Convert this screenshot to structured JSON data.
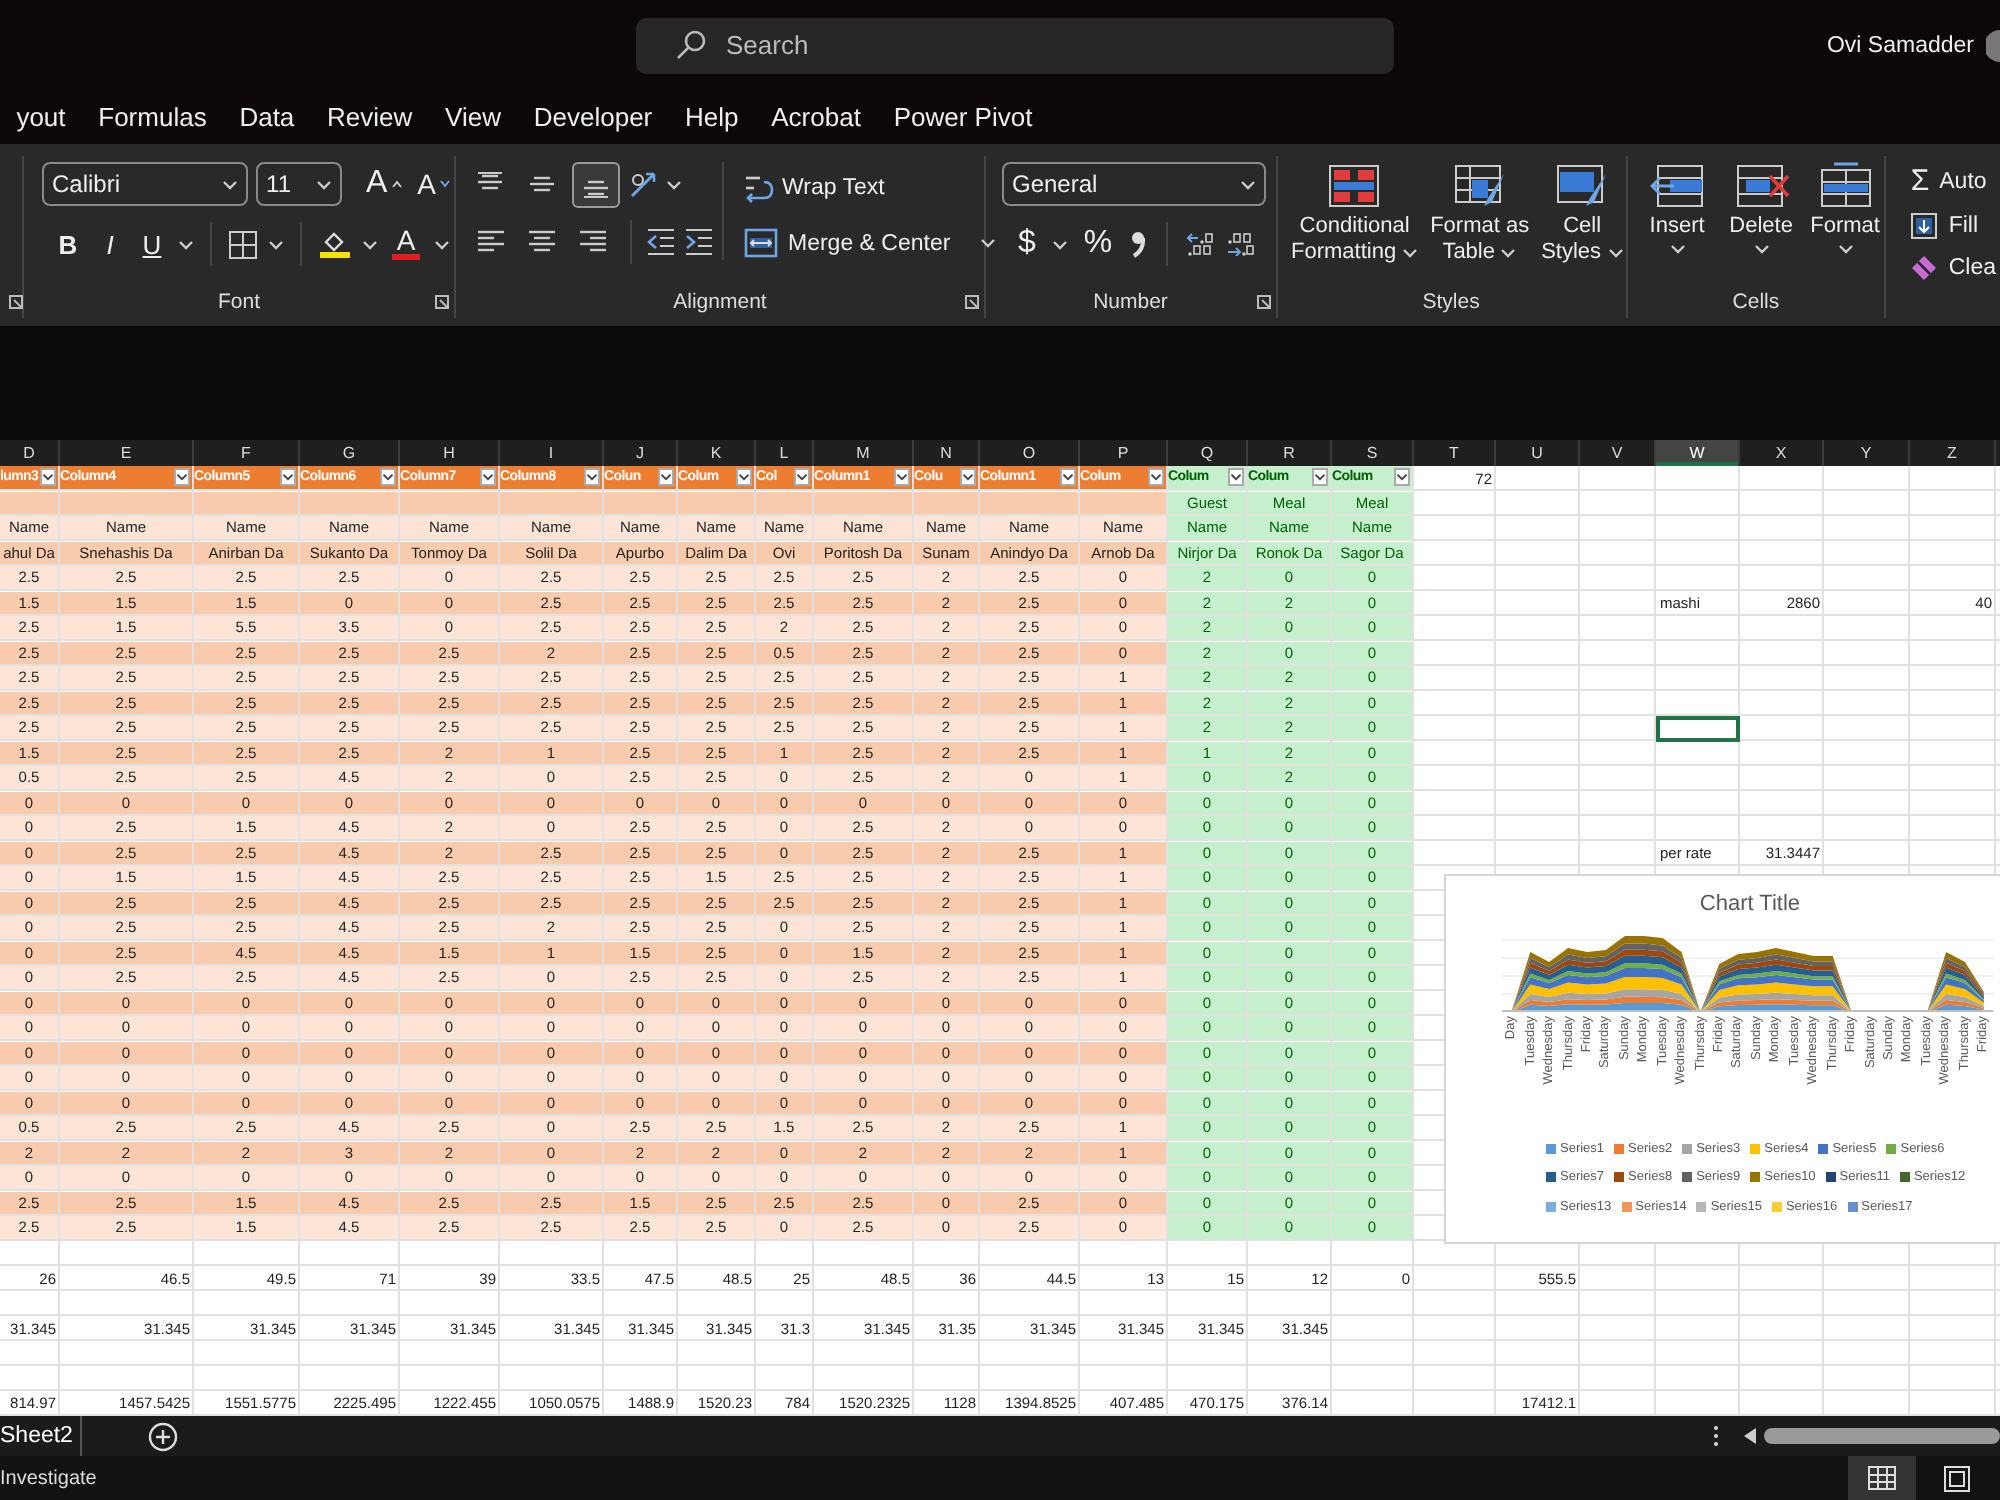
{
  "title_bar": {
    "search_placeholder": "Search",
    "user_name": "Ovi Samadder"
  },
  "menu_tabs": [
    "yout",
    "Formulas",
    "Data",
    "Review",
    "View",
    "Developer",
    "Help",
    "Acrobat",
    "Power Pivot"
  ],
  "ribbon": {
    "groups": [
      {
        "kind": "font",
        "label": "Font",
        "font_name": "Calibri",
        "font_size": "11",
        "grow_font": "A",
        "shrink_font": "A",
        "style_buttons": [
          "B",
          "I",
          "U"
        ],
        "font_color": "A"
      },
      {
        "kind": "alignment",
        "label": "Alignment",
        "valign_buttons": [
          {
            "selected": false
          },
          {
            "selected": false
          },
          {
            "selected": true
          }
        ],
        "wrap_text": "Wrap Text",
        "merge": "Merge & Center"
      },
      {
        "kind": "number",
        "label": "Number",
        "format": "General",
        "currency": "$",
        "percent": "%"
      },
      {
        "kind": "styles",
        "label": "Styles",
        "buttons": [
          "Conditional\nFormatting",
          "Format as\nTable",
          "Cell\nStyles"
        ]
      },
      {
        "kind": "cells",
        "label": "Cells",
        "buttons": [
          "Insert",
          "Delete",
          "Format"
        ]
      },
      {
        "kind": "editing",
        "autosum_symbol": "Σ",
        "buttons": [
          "Auto",
          "Fill",
          "Clea"
        ]
      }
    ]
  },
  "sheet": {
    "columns": [
      {
        "letter": "D",
        "kind": "orange",
        "selected": false
      },
      {
        "letter": "E",
        "kind": "orange",
        "selected": false
      },
      {
        "letter": "F",
        "kind": "orange",
        "selected": false
      },
      {
        "letter": "G",
        "kind": "orange",
        "selected": false
      },
      {
        "letter": "H",
        "kind": "orange",
        "selected": false
      },
      {
        "letter": "I",
        "kind": "orange",
        "selected": false
      },
      {
        "letter": "J",
        "kind": "orange",
        "selected": false
      },
      {
        "letter": "K",
        "kind": "orange",
        "selected": false
      },
      {
        "letter": "L",
        "kind": "orange",
        "selected": false
      },
      {
        "letter": "M",
        "kind": "orange",
        "selected": false
      },
      {
        "letter": "N",
        "kind": "orange",
        "selected": false
      },
      {
        "letter": "O",
        "kind": "orange",
        "selected": false
      },
      {
        "letter": "P",
        "kind": "orange",
        "selected": false
      },
      {
        "letter": "Q",
        "kind": "green",
        "selected": false
      },
      {
        "letter": "R",
        "kind": "green",
        "selected": false
      },
      {
        "letter": "S",
        "kind": "green",
        "selected": false
      },
      {
        "letter": "T",
        "kind": "plain",
        "selected": false
      },
      {
        "letter": "U",
        "kind": "plain",
        "selected": false
      },
      {
        "letter": "V",
        "kind": "plain",
        "selected": false
      },
      {
        "letter": "W",
        "kind": "plain",
        "selected": true
      },
      {
        "letter": "X",
        "kind": "plain",
        "selected": false
      },
      {
        "letter": "Y",
        "kind": "plain",
        "selected": false
      },
      {
        "letter": "Z",
        "kind": "plain",
        "selected": false
      }
    ],
    "rows": [
      {
        "kind": "header",
        "cells": [
          "lumn3",
          "Column4",
          "Column5",
          "Column6",
          "Column7",
          "Column8",
          "Colun",
          "Colum",
          "Col",
          "Column1",
          "Colu",
          "Column1",
          "Colum",
          "Colum",
          "Colum",
          "Colum",
          "72"
        ]
      },
      {
        "kind": "band",
        "cells": [
          null,
          null,
          null,
          null,
          null,
          null,
          null,
          null,
          null,
          null,
          null,
          null,
          null,
          "Guest",
          "Meal",
          "Meal"
        ]
      },
      {
        "kind": "band",
        "cells": [
          "Name",
          "Name",
          "Name",
          "Name",
          "Name",
          "Name",
          "Name",
          "Name",
          "Name",
          "Name",
          "Name",
          "Name",
          "Name",
          "Name",
          "Name",
          "Name"
        ]
      },
      {
        "kind": "band",
        "cells": [
          "ahul Da",
          "Snehashis Da",
          "Anirban Da",
          "Sukanto Da",
          "Tonmoy Da",
          "Solil Da",
          "Apurbo",
          "Dalim Da",
          "Ovi",
          "Poritosh Da",
          "Sunam",
          "Anindyo Da",
          "Arnob Da",
          "Nirjor Da",
          "Ronok Da",
          "Sagor Da"
        ]
      },
      {
        "kind": "band",
        "cells": [
          "2.5",
          "2.5",
          "2.5",
          "2.5",
          "0",
          "2.5",
          "2.5",
          "2.5",
          "2.5",
          "2.5",
          "2",
          "2.5",
          "0",
          "2",
          "0",
          "0"
        ]
      },
      {
        "kind": "band",
        "cells": [
          "1.5",
          "1.5",
          "1.5",
          "0",
          "0",
          "2.5",
          "2.5",
          "2.5",
          "2.5",
          "2.5",
          "2",
          "2.5",
          "0",
          "2",
          "2",
          "0",
          null,
          null,
          null,
          "mashi",
          "2860",
          null,
          "40"
        ]
      },
      {
        "kind": "band",
        "cells": [
          "2.5",
          "1.5",
          "5.5",
          "3.5",
          "0",
          "2.5",
          "2.5",
          "2.5",
          "2",
          "2.5",
          "2",
          "2.5",
          "0",
          "2",
          "0",
          "0"
        ]
      },
      {
        "kind": "band",
        "cells": [
          "2.5",
          "2.5",
          "2.5",
          "2.5",
          "2.5",
          "2",
          "2.5",
          "2.5",
          "0.5",
          "2.5",
          "2",
          "2.5",
          "0",
          "2",
          "0",
          "0"
        ]
      },
      {
        "kind": "band",
        "cells": [
          "2.5",
          "2.5",
          "2.5",
          "2.5",
          "2.5",
          "2.5",
          "2.5",
          "2.5",
          "2.5",
          "2.5",
          "2",
          "2.5",
          "1",
          "2",
          "2",
          "0"
        ]
      },
      {
        "kind": "band",
        "cells": [
          "2.5",
          "2.5",
          "2.5",
          "2.5",
          "2.5",
          "2.5",
          "2.5",
          "2.5",
          "2.5",
          "2.5",
          "2",
          "2.5",
          "1",
          "2",
          "2",
          "0"
        ]
      },
      {
        "kind": "band",
        "cells": [
          "2.5",
          "2.5",
          "2.5",
          "2.5",
          "2.5",
          "2.5",
          "2.5",
          "2.5",
          "2.5",
          "2.5",
          "2",
          "2.5",
          "1",
          "2",
          "2",
          "0",
          null,
          null,
          null,
          {
            "selected": true
          }
        ]
      },
      {
        "kind": "band",
        "cells": [
          "1.5",
          "2.5",
          "2.5",
          "2.5",
          "2",
          "1",
          "2.5",
          "2.5",
          "1",
          "2.5",
          "2",
          "2.5",
          "1",
          "1",
          "2",
          "0"
        ]
      },
      {
        "kind": "band",
        "cells": [
          "0.5",
          "2.5",
          "2.5",
          "4.5",
          "2",
          "0",
          "2.5",
          "2.5",
          "0",
          "2.5",
          "2",
          "0",
          "1",
          "0",
          "2",
          "0"
        ]
      },
      {
        "kind": "band",
        "cells": [
          "0",
          "0",
          "0",
          "0",
          "0",
          "0",
          "0",
          "0",
          "0",
          "0",
          "0",
          "0",
          "0",
          "0",
          "0",
          "0"
        ]
      },
      {
        "kind": "band",
        "cells": [
          "0",
          "2.5",
          "1.5",
          "4.5",
          "2",
          "0",
          "2.5",
          "2.5",
          "0",
          "2.5",
          "2",
          "0",
          "0",
          "0",
          "0",
          "0"
        ]
      },
      {
        "kind": "band",
        "cells": [
          "0",
          "2.5",
          "2.5",
          "4.5",
          "2",
          "2.5",
          "2.5",
          "2.5",
          "0",
          "2.5",
          "2",
          "2.5",
          "1",
          "0",
          "0",
          "0",
          null,
          null,
          null,
          "per rate",
          "31.3447"
        ]
      },
      {
        "kind": "band",
        "cells": [
          "0",
          "1.5",
          "1.5",
          "4.5",
          "2.5",
          "2.5",
          "2.5",
          "1.5",
          "2.5",
          "2.5",
          "2",
          "2.5",
          "1",
          "0",
          "0",
          "0"
        ]
      },
      {
        "kind": "band",
        "cells": [
          "0",
          "2.5",
          "2.5",
          "4.5",
          "2.5",
          "2.5",
          "2.5",
          "2.5",
          "2.5",
          "2.5",
          "2",
          "2.5",
          "1",
          "0",
          "0",
          "0"
        ]
      },
      {
        "kind": "band",
        "cells": [
          "0",
          "2.5",
          "2.5",
          "4.5",
          "2.5",
          "2",
          "2.5",
          "2.5",
          "0",
          "2.5",
          "2",
          "2.5",
          "1",
          "0",
          "0",
          "0"
        ]
      },
      {
        "kind": "band",
        "cells": [
          "0",
          "2.5",
          "4.5",
          "4.5",
          "1.5",
          "1",
          "1.5",
          "2.5",
          "0",
          "1.5",
          "2",
          "2.5",
          "1",
          "0",
          "0",
          "0"
        ]
      },
      {
        "kind": "band",
        "cells": [
          "0",
          "2.5",
          "2.5",
          "4.5",
          "2.5",
          "0",
          "2.5",
          "2.5",
          "0",
          "2.5",
          "2",
          "2.5",
          "1",
          "0",
          "0",
          "0"
        ]
      },
      {
        "kind": "band",
        "cells": [
          "0",
          "0",
          "0",
          "0",
          "0",
          "0",
          "0",
          "0",
          "0",
          "0",
          "0",
          "0",
          "0",
          "0",
          "0",
          "0"
        ]
      },
      {
        "kind": "band",
        "cells": [
          "0",
          "0",
          "0",
          "0",
          "0",
          "0",
          "0",
          "0",
          "0",
          "0",
          "0",
          "0",
          "0",
          "0",
          "0",
          "0"
        ]
      },
      {
        "kind": "band",
        "cells": [
          "0",
          "0",
          "0",
          "0",
          "0",
          "0",
          "0",
          "0",
          "0",
          "0",
          "0",
          "0",
          "0",
          "0",
          "0",
          "0"
        ]
      },
      {
        "kind": "band",
        "cells": [
          "0",
          "0",
          "0",
          "0",
          "0",
          "0",
          "0",
          "0",
          "0",
          "0",
          "0",
          "0",
          "0",
          "0",
          "0",
          "0"
        ]
      },
      {
        "kind": "band",
        "cells": [
          "0",
          "0",
          "0",
          "0",
          "0",
          "0",
          "0",
          "0",
          "0",
          "0",
          "0",
          "0",
          "0",
          "0",
          "0",
          "0"
        ]
      },
      {
        "kind": "band",
        "cells": [
          "0.5",
          "2.5",
          "2.5",
          "4.5",
          "2.5",
          "0",
          "2.5",
          "2.5",
          "1.5",
          "2.5",
          "2",
          "2.5",
          "1",
          "0",
          "0",
          "0"
        ]
      },
      {
        "kind": "band",
        "cells": [
          "2",
          "2",
          "2",
          "3",
          "2",
          "0",
          "2",
          "2",
          "0",
          "2",
          "2",
          "2",
          "1",
          "0",
          "0",
          "0"
        ]
      },
      {
        "kind": "band",
        "cells": [
          "0",
          "0",
          "0",
          "0",
          "0",
          "0",
          "0",
          "0",
          "0",
          "0",
          "0",
          "0",
          "0",
          "0",
          "0",
          "0"
        ]
      },
      {
        "kind": "band",
        "cells": [
          "2.5",
          "2.5",
          "1.5",
          "4.5",
          "2.5",
          "2.5",
          "1.5",
          "2.5",
          "2.5",
          "2.5",
          "0",
          "2.5",
          "0",
          "0",
          "0",
          "0"
        ]
      },
      {
        "kind": "band",
        "cells": [
          "2.5",
          "2.5",
          "1.5",
          "4.5",
          "2.5",
          "2.5",
          "2.5",
          "2.5",
          "0",
          "2.5",
          "0",
          "2.5",
          "0",
          "0",
          "0",
          "0"
        ]
      },
      {
        "kind": "plain"
      },
      {
        "kind": "plain",
        "cells": [
          "26",
          "46.5",
          "49.5",
          "71",
          "39",
          "33.5",
          "47.5",
          "48.5",
          "25",
          "48.5",
          "36",
          "44.5",
          "13",
          "15",
          "12",
          "0",
          null,
          "555.5"
        ]
      },
      {
        "kind": "plain"
      },
      {
        "kind": "plain",
        "cells": [
          "31.345",
          "31.345",
          "31.345",
          "31.345",
          "31.345",
          "31.345",
          "31.345",
          "31.345",
          "31.3",
          "31.345",
          "31.35",
          "31.345",
          "31.345",
          "31.345",
          "31.345"
        ]
      },
      {
        "kind": "plain"
      },
      {
        "kind": "plain"
      },
      {
        "kind": "plain",
        "cells": [
          "814.97",
          "1457.5425",
          "1551.5775",
          "2225.495",
          "1222.455",
          "1050.0575",
          "1488.9",
          "1520.23",
          "784",
          "1520.2325",
          "1128",
          "1394.8525",
          "407.485",
          "470.175",
          "376.14",
          null,
          null,
          "17412.1"
        ]
      }
    ]
  },
  "chart": {
    "title": "Chart Title",
    "categories": [
      "Day",
      "Tuesday",
      "Wednesday",
      "Thursday",
      "Friday",
      "Saturday",
      "Sunday",
      "Monday",
      "Tuesday",
      "Wednesday",
      "Thursday",
      "Friday",
      "Saturday",
      "Sunday",
      "Monday",
      "Tuesday",
      "Wednesday",
      "Thursday",
      "Friday",
      "Saturday",
      "Sunday",
      "Monday",
      "Tuesday",
      "Wednesday",
      "Thursday",
      "Friday"
    ],
    "legend": [
      {
        "name": "Series1",
        "color": "#5b9bd5"
      },
      {
        "name": "Series2",
        "color": "#ed7d31"
      },
      {
        "name": "Series3",
        "color": "#a5a5a5"
      },
      {
        "name": "Series4",
        "color": "#ffc000"
      },
      {
        "name": "Series5",
        "color": "#4472c4"
      },
      {
        "name": "Series6",
        "color": "#70ad47"
      },
      {
        "name": "Series7",
        "color": "#255e91"
      },
      {
        "name": "Series8",
        "color": "#9e480e"
      },
      {
        "name": "Series9",
        "color": "#636363"
      },
      {
        "name": "Series10",
        "color": "#997300"
      },
      {
        "name": "Series11",
        "color": "#264478"
      },
      {
        "name": "Series12",
        "color": "#43682b"
      },
      {
        "name": "Series13",
        "color": "#7cafdd"
      },
      {
        "name": "Series14",
        "color": "#f1975a"
      },
      {
        "name": "Series15",
        "color": "#b7b7b7"
      },
      {
        "name": "Series16",
        "color": "#ffcd33"
      },
      {
        "name": "Series17",
        "color": "#698ed0"
      }
    ]
  },
  "sheet_tabs": [
    "Sheet2"
  ],
  "status_bar": {
    "text": "Investigate",
    "views": [
      {
        "selected": true
      },
      {
        "selected": false
      }
    ]
  }
}
